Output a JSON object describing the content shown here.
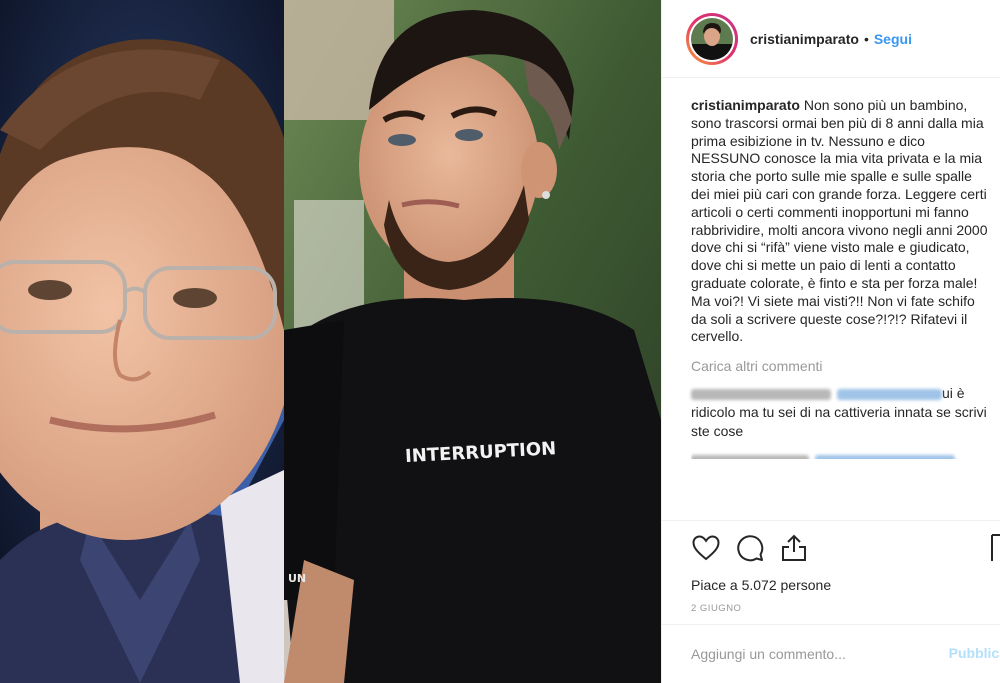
{
  "post": {
    "image_alt": "child and adult photos",
    "shirt_text": "INTERRUPTION",
    "sleeve_text": "UN"
  },
  "header": {
    "username": "cristianimparato",
    "separator": "•",
    "follow_label": "Segui"
  },
  "caption": {
    "username": "cristianimparato",
    "text": "Non sono più un bambino, sono trascorsi ormai ben più di 8 anni dalla mia prima esibizione in tv. Nessuno e dico NESSUNO conosce la mia vita privata e la mia storia che porto sulle mie spalle e sulle spalle dei miei più cari con grande forza. Leggere certi articoli o certi commenti inopportuni mi fanno rabbrividire, molti ancora vivono negli anni 2000 dove chi si “rifà” viene visto male e giudicato, dove chi si mette un paio di lenti a contatto graduate colorate, è finto e sta per forza male! Ma voi?! Vi siete mai visti?!! Non vi fate schifo da soli a scrivere queste cose?!?!? Rifatevi il cervello."
  },
  "load_more_label": "Carica altri commenti",
  "comments": [
    {
      "text_end": "ui è ridicolo ma tu sei di na cattiveria innata se scrivi ste cose"
    }
  ],
  "actions": {
    "likes_text": "Piace a 5.072 persone",
    "date": "2 GIUGNO"
  },
  "comment_input": {
    "placeholder": "Aggiungi un commento...",
    "post_label": "Pubblica"
  },
  "colors": {
    "accent": "#3897f0",
    "text": "#262626",
    "muted": "#999999",
    "border": "#efefef"
  }
}
